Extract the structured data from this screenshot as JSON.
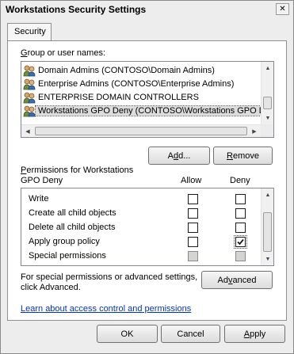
{
  "window": {
    "title": "Workstations Security Settings",
    "close_glyph": "✕"
  },
  "tabs": [
    {
      "label": "Security"
    }
  ],
  "users": {
    "label_pre": "",
    "label_key": "G",
    "label_post": "roup or user names:",
    "items": [
      {
        "name": "Domain Admins (CONTOSO\\Domain Admins)",
        "icon": "group-icon",
        "selected": false
      },
      {
        "name": "Enterprise Admins (CONTOSO\\Enterprise Admins)",
        "icon": "group-icon",
        "selected": false
      },
      {
        "name": "ENTERPRISE DOMAIN CONTROLLERS",
        "icon": "group-icon",
        "selected": false
      },
      {
        "name": "Workstations GPO Deny (CONTOSO\\Workstations GPO D",
        "icon": "group-icon",
        "selected": true
      }
    ]
  },
  "buttons": {
    "add_pre": "A",
    "add_key": "d",
    "add_post": "d...",
    "remove_pre": "",
    "remove_key": "R",
    "remove_post": "emove",
    "advanced_pre": "Ad",
    "advanced_key": "v",
    "advanced_post": "anced",
    "ok": "OK",
    "cancel": "Cancel",
    "apply_pre": "",
    "apply_key": "A",
    "apply_post": "pply"
  },
  "permissions": {
    "label_pre": "",
    "label_key": "P",
    "label_post": "ermissions for Workstations",
    "label_line2": "GPO Deny",
    "col_allow": "Allow",
    "col_deny": "Deny",
    "rows": [
      {
        "name": "Write",
        "allow": "unchecked",
        "deny": "unchecked"
      },
      {
        "name": "Create all child objects",
        "allow": "unchecked",
        "deny": "unchecked"
      },
      {
        "name": "Delete all child objects",
        "allow": "unchecked",
        "deny": "unchecked"
      },
      {
        "name": "Apply group policy",
        "allow": "unchecked",
        "deny": "checked"
      },
      {
        "name": "Special permissions",
        "allow": "disabled",
        "deny": "disabled"
      }
    ]
  },
  "special_note": {
    "line1": "For special permissions or advanced settings,",
    "line2": "click Advanced."
  },
  "help_link": "Learn about access control and permissions"
}
